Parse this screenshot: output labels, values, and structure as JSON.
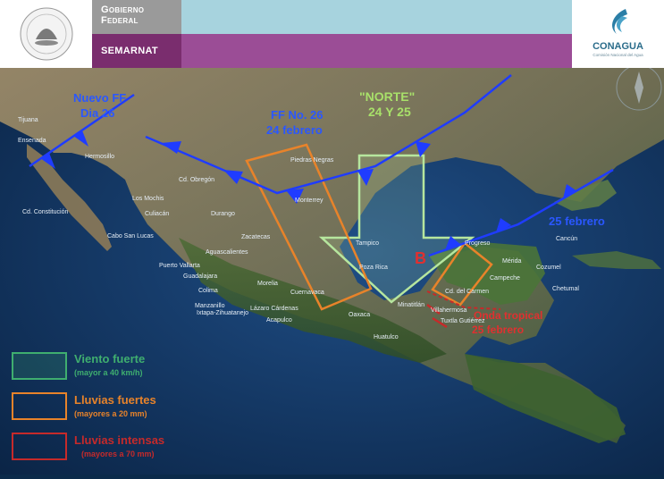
{
  "header": {
    "gov_line1": "Gobierno",
    "gov_line2": "Federal",
    "agency": "SEMARNAT",
    "seal_text": "ESTADOS UNIDOS MEXICANOS",
    "logo_text": "CONAGUA",
    "logo_sub": "Comisión Nacional del Agua"
  },
  "annotations": {
    "nuevo_ff": "Nuevo FF",
    "dia_26": "Dia 26",
    "ff_no_26": "FF No. 26",
    "feb_24": "24 febrero",
    "norte": "\"NORTE\"",
    "norte_dates": "24 Y 25",
    "feb_25": "25 febrero",
    "low_marker": "B",
    "tropical_label": "Onda tropical",
    "tropical_date": "25 febrero"
  },
  "places": [
    "Tijuana",
    "Ensenada",
    "Hermosillo",
    "Cd. Obregón",
    "Los Mochis",
    "Culiacán",
    "Cd. Constitución",
    "Cabo San Lucas",
    "Durango",
    "Zacatecas",
    "Aguascalientes",
    "Guadalajara",
    "Puerto Vallarta",
    "Colima",
    "Manzanillo",
    "Morelia",
    "Lázaro Cárdenas",
    "Ixtapa-Zihuatanejo",
    "Acapulco",
    "Cuernavaca",
    "Oaxaca",
    "Huatulco",
    "Tampico",
    "Poza Rica",
    "Piedras Negras",
    "Monterrey",
    "Minatitlán",
    "Villahermosa",
    "Tuxtla Gutiérrez",
    "Cd. del Carmen",
    "Mérida",
    "Campeche",
    "Cancún",
    "Cozumel",
    "Chetumal",
    "Progreso"
  ],
  "legend": [
    {
      "title": "Viento fuerte",
      "sub": "(mayor a 40 km/h)",
      "color": "#3fae6f"
    },
    {
      "title": "Lluvias fuertes",
      "sub": "(mayores a 20 mm)",
      "color": "#e8832a"
    },
    {
      "title": "Lluvias intensas",
      "sub": "(mayores a 70 mm)",
      "color": "#c62a2a"
    }
  ],
  "colors": {
    "front": "#1f3cff",
    "wind_arrow": "#b6e69e",
    "rain_heavy": "#e8832a",
    "rain_intense": "#c62a2a",
    "label_blue": "#2a57ff",
    "label_green": "#a8e06a",
    "label_red": "#e03030"
  }
}
